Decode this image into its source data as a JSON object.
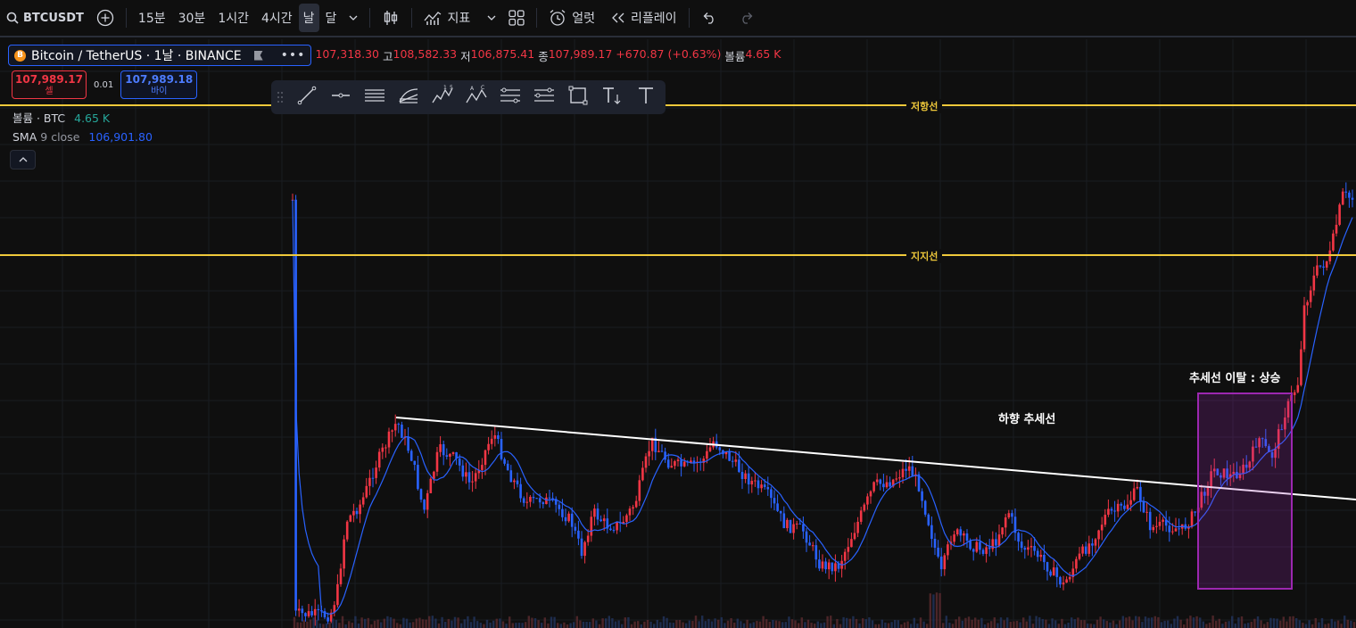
{
  "toolbar": {
    "symbol": "BTCUSDT",
    "timeframes": [
      "15분",
      "30분",
      "1시간",
      "4시간",
      "날",
      "달"
    ],
    "indicators_label": "지표",
    "alert_label": "얼럿",
    "replay_label": "리플레이"
  },
  "legend": {
    "title": "Bitcoin / TetherUS · 1날 · BINANCE",
    "coin_glyph": "B",
    "open_value": "107,318.30",
    "high_label": "고",
    "high_value": "108,582.33",
    "low_label": "저",
    "low_value": "106,875.41",
    "close_label": "종",
    "close_value": "107,989.17",
    "change": "+670.87 (+0.63%)",
    "volume_label": "볼륨",
    "volume_value": "4.65 K"
  },
  "trade": {
    "sell_price": "107,989.17",
    "sell_label": "셀",
    "spread": "0.01",
    "buy_price": "107,989.18",
    "buy_label": "바이"
  },
  "indicators": {
    "volume_name": "볼륨 · BTC",
    "volume_value": "4.65 K",
    "sma_name": "SMA",
    "sma_params": "9 close",
    "sma_value": "106,901.80"
  },
  "drawings": {
    "resistance_label": "저항선",
    "support_label": "지지선",
    "downtrend_label": "하향 추세선",
    "breakout_label": "추세선 이탈 : 상승"
  },
  "colors": {
    "up": "#f23645",
    "down": "#2962ff",
    "sma": "#2962ff",
    "hline": "#f0c93a",
    "box": "#9c27b0"
  },
  "chart_data": {
    "type": "candlestick",
    "symbol": "BTCUSDT",
    "timeframe": "1 day",
    "last_close": 107989.17,
    "sma9": 106901.8,
    "y_approx": [
      96000,
      112000
    ]
  }
}
